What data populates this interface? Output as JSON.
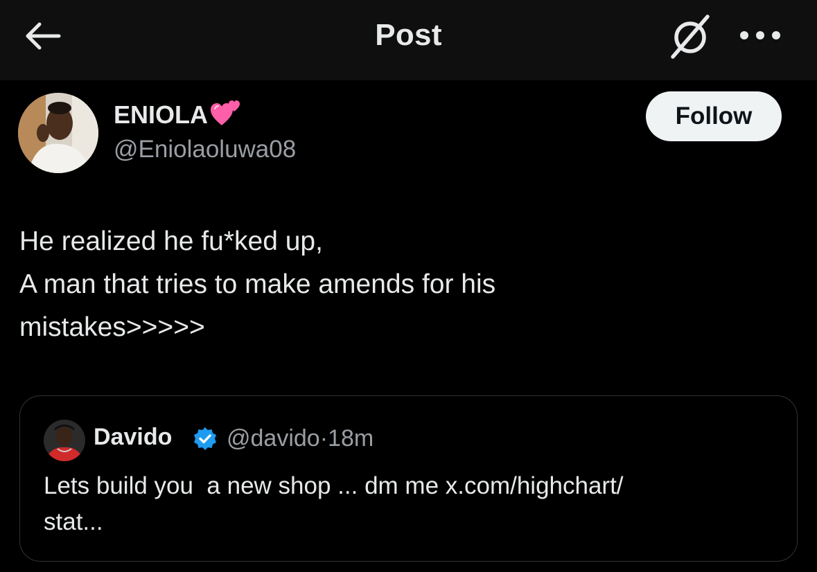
{
  "header": {
    "title": "Post",
    "back_icon": "arrow-left-icon",
    "grok_icon": "grok-icon",
    "more_icon": "more-horizontal-icon"
  },
  "author": {
    "display_name": "ENIOLA",
    "name_emoji": "two-hearts-icon",
    "handle": "@Eniolaoluwa08",
    "follow_label": "Follow"
  },
  "post": {
    "lines": [
      "He realized he fu*ked up,",
      "A man that tries to make amends for his",
      "mistakes>>>>>"
    ]
  },
  "quoted_post": {
    "display_name": "Davido",
    "verified_icon": "verified-badge-icon",
    "handle": "@davido",
    "separator": "·",
    "time": "18m",
    "lines": [
      "Lets build you  a new shop ... dm me x.com/highchart/",
      "stat..."
    ]
  },
  "colors": {
    "background": "#000000",
    "header_bg": "#0f0f0f",
    "text_primary": "#e7e9ea",
    "text_secondary": "#9a9fa4",
    "follow_bg": "#eff3f4",
    "verified_blue": "#1d9bf0",
    "border": "#2f3336",
    "heart_pink": "#ff5fa8"
  }
}
